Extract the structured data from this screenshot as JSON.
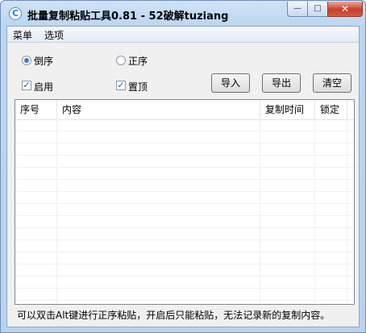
{
  "window": {
    "title": "批量复制粘贴工具0.81 - 52破解tuziang",
    "app_icon_glyph": "C",
    "minimize_glyph": "—",
    "maximize_glyph": "□",
    "close_glyph": "✕"
  },
  "menu": {
    "items": [
      {
        "label": "菜单"
      },
      {
        "label": "选项"
      }
    ]
  },
  "controls": {
    "order_reverse": {
      "label": "倒序",
      "checked": true
    },
    "order_forward": {
      "label": "正序",
      "checked": false
    },
    "enable": {
      "label": "启用",
      "checked": true
    },
    "pin_top": {
      "label": "置顶",
      "checked": true
    },
    "check_glyph": "✓"
  },
  "buttons": {
    "import": "导入",
    "export": "导出",
    "clear": "清空"
  },
  "table": {
    "columns": [
      "序号",
      "内容",
      "复制时间",
      "锁定"
    ],
    "rows": []
  },
  "status": {
    "text": "可以双击Alt键进行正序粘贴，开启后只能粘贴，无法记录新的复制内容。"
  },
  "colors": {
    "title_bar": "#bcd6f1",
    "client_bg": "#f0f0f0",
    "close_button": "#c7402b",
    "accent": "#3c7dc4"
  }
}
